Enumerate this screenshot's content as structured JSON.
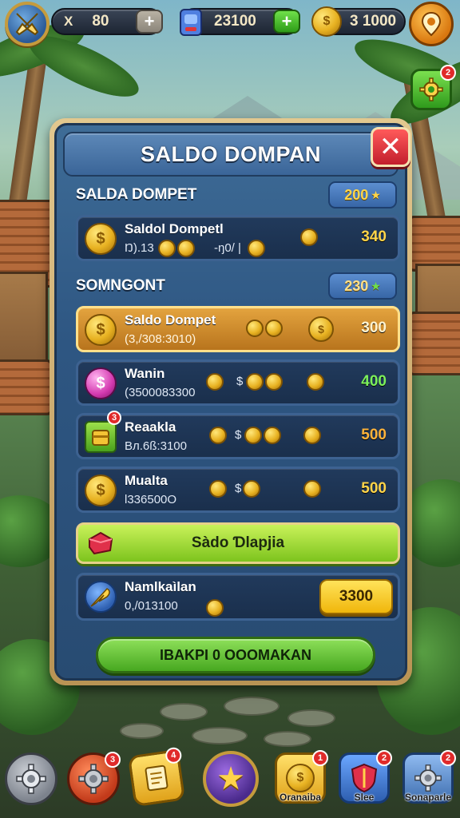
{
  "topbar": {
    "avatar_icon": "crossed-swords-icon",
    "stat1": {
      "prefix": "X",
      "value": "80",
      "action_icon": "plus-icon"
    },
    "stat2": {
      "icon": "gem-can-icon",
      "value": "23100",
      "action_icon": "plus-icon"
    },
    "stat3": {
      "icon": "gold-coin-icon",
      "value": "3 1000"
    },
    "map_pin_icon": "map-pin-icon",
    "settings_badge": "2"
  },
  "dialog": {
    "title": "SALDO DOMPAN",
    "close_icon": "close-icon",
    "section1": {
      "label": "SALDA DOMPET",
      "badge_value": "200",
      "badge_icon": "star-icon"
    },
    "section2": {
      "label": "SOMNGONT",
      "badge_value": "230",
      "badge_icon": "star-icon"
    },
    "rows": [
      {
        "title": "Saldol Dompetl",
        "sub": "Ŋ).13",
        "sub2": "-ŋ0/ |",
        "value": "340",
        "value_color": "#ffd54a",
        "icon": "gold-coin-icon"
      },
      {
        "title": "Saldo Dompet",
        "sub": "(3,/308:3010)",
        "sub2": "",
        "value": "300",
        "value_color": "#fff3d0",
        "icon": "gold-coin-icon"
      },
      {
        "title": "Wanin",
        "sub": "(3500083300",
        "sub2": "$",
        "value": "400",
        "value_color": "#7cf05a",
        "icon": "pink-coin-icon"
      },
      {
        "title": "Reaakla",
        "sub": "Bл.6ß:3100",
        "sub2": "$",
        "value": "500",
        "value_color": "#ffb33a",
        "icon": "treasure-icon",
        "badge": "3"
      },
      {
        "title": "Mualta",
        "sub": "l336500O",
        "sub2": "$",
        "value": "500",
        "value_color": "#ffd54a",
        "icon": "gold-coin-icon"
      }
    ],
    "green_bar": {
      "label": "Sàdo Ɗlapjia",
      "icon": "red-gem-icon"
    },
    "last_row": {
      "title": "Namlkaìlan",
      "sub": "0,/013100",
      "button": "3300",
      "icon": "wings-icon"
    },
    "main_button": "IBAKPI 0 OOOMAKAN"
  },
  "bottombar": {
    "items": [
      {
        "label": "",
        "icon": "gear-icon",
        "badge": ""
      },
      {
        "label": "",
        "icon": "gear-icon",
        "badge": "3"
      },
      {
        "label": "",
        "icon": "scroll-icon",
        "badge": "4"
      },
      {
        "label": "",
        "icon": "star-icon",
        "badge": ""
      },
      {
        "label": "Oranaiba",
        "icon": "coins-stack-icon",
        "badge": "1"
      },
      {
        "label": "Slee",
        "icon": "shield-icon",
        "badge": "2"
      },
      {
        "label": "Sonaparle",
        "icon": "gear-icon",
        "badge": "2"
      }
    ]
  }
}
